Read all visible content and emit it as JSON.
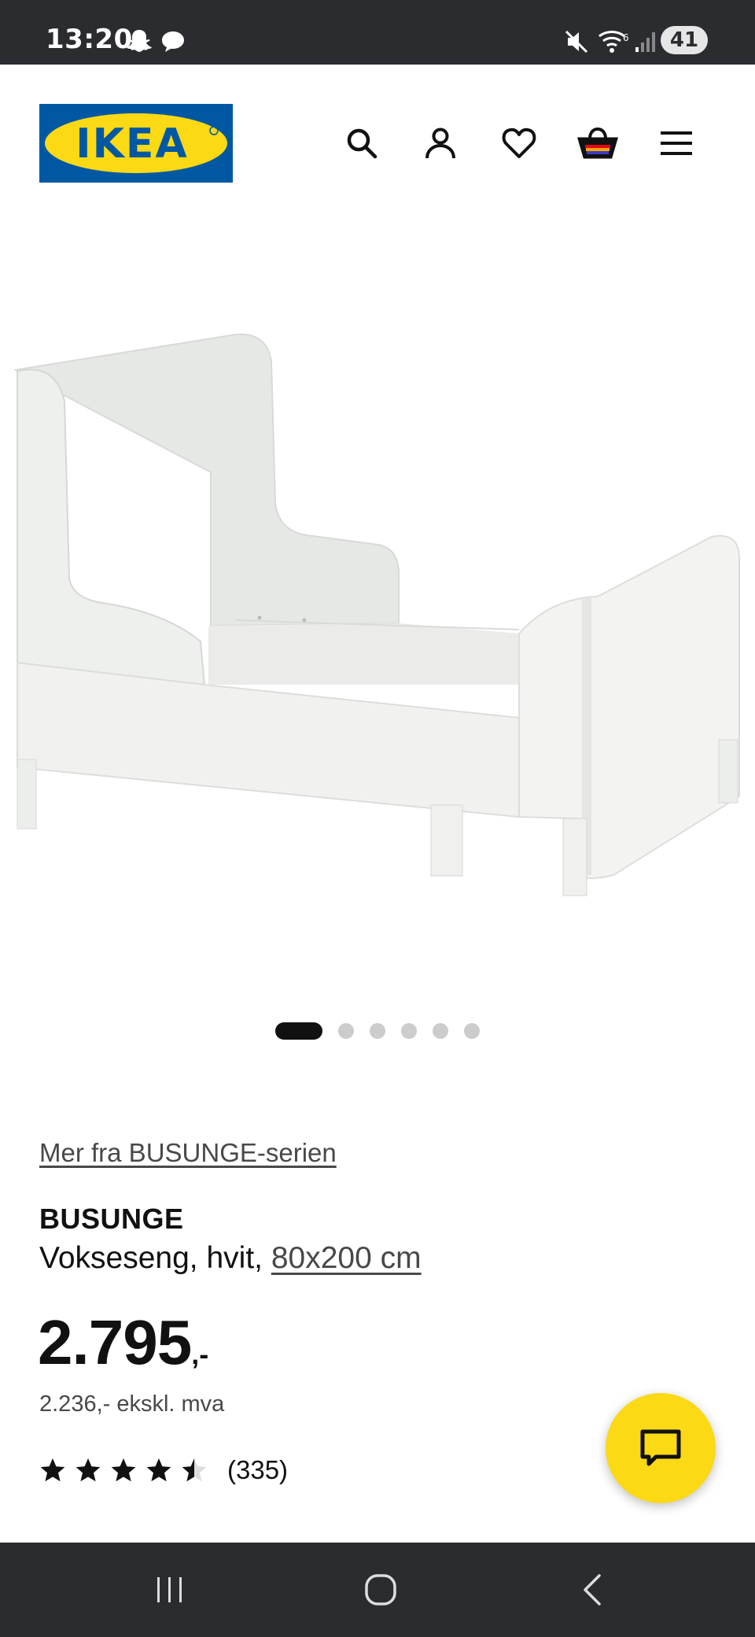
{
  "status_bar": {
    "time": "13:20",
    "battery": "41",
    "icons": [
      "snapchat-icon",
      "chat-bubble-icon",
      "mute-icon",
      "wifi-icon",
      "signal-icon"
    ]
  },
  "header": {
    "logo_text": "IKEA",
    "logo_colors": {
      "blue": "#0058a3",
      "yellow": "#fbd914"
    },
    "icons": [
      "search-icon",
      "account-icon",
      "heart-icon",
      "cart-icon",
      "menu-icon"
    ]
  },
  "gallery": {
    "image_count": 6,
    "active_index": 0
  },
  "product": {
    "series_link": "Mer fra BUSUNGE-serien",
    "name": "BUSUNGE",
    "description_prefix": "Vokseseng, hvit, ",
    "size_link": "80x200 cm",
    "price_main": "2.795",
    "price_suffix": ",-",
    "price_excl_vat": "2.236,- ekskl. mva",
    "rating_value": 4.5,
    "rating_max": 5,
    "rating_count": "(335)"
  },
  "chat": {
    "icon": "chat-icon",
    "color": "#fbd914"
  },
  "nav_bar": {
    "icons": [
      "recent-apps-icon",
      "home-icon",
      "back-icon"
    ]
  }
}
